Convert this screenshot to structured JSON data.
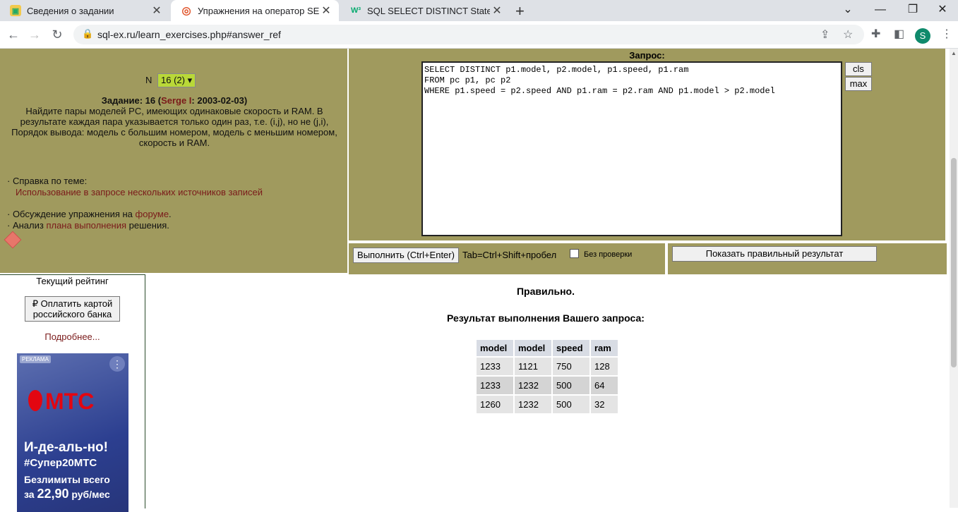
{
  "browser": {
    "tabs": [
      {
        "title": "Сведения о задании",
        "icon": "task-favicon"
      },
      {
        "title": "Упражнения на оператор SELECT",
        "icon": "sqlex-favicon"
      },
      {
        "title": "SQL SELECT DISTINCT Statement",
        "icon": "w3schools-favicon"
      }
    ],
    "url": "sql-ex.ru/learn_exercises.php#answer_ref",
    "profile_letter": "S"
  },
  "left": {
    "n_label": "N",
    "n_value": "16 (2)",
    "task_prefix": "Задание: 16 (",
    "task_author": "Serge I",
    "task_date": ": 2003-02-03)",
    "task_text": "Найдите пары моделей PC, имеющих одинаковые скорость и RAM. В результате каждая пара указывается только один раз, т.е. (i,j), но не (j,i), Порядок вывода: модель с большим номером, модель с меньшим номером, скорость и RAM.",
    "help_label": "· Справка по теме:",
    "help_link": "Использование в запросе нескольких источников записей",
    "forum_pre": "· Обсуждение упражнения на ",
    "forum_link": "форуме",
    "forum_post": ".",
    "plan_pre": "· Анализ ",
    "plan_link": "плана выполнения",
    "plan_post": " решения."
  },
  "query": {
    "label": "Запрос:",
    "text": "SELECT DISTINCT p1.model, p2.model, p1.speed, p1.ram\nFROM pc p1, pc p2\nWHERE p1.speed = p2.speed AND p1.ram = p2.ram AND p1.model > p2.model",
    "cls_label": "cls",
    "max_label": "max",
    "execute_label": "Выполнить (Ctrl+Enter)",
    "tab_hint": "Tab=Ctrl+Shift+пробел",
    "nocheck_label": "Без проверки",
    "show_result_label": "Показать правильный результат"
  },
  "sidebar": {
    "rating_label": "Текущий рейтинг",
    "pay_label": "₽ Оплатить картой российского банка",
    "more_label": "Подробнее...",
    "ad": {
      "badge": "РЕКЛАМА",
      "brand": "МТС",
      "line1": "И-де-аль-но!",
      "line2": "#Супер20МТС",
      "line3": "Безлимиты всего",
      "line4_pre": "за ",
      "line4_price": "22,90",
      "line4_post": " руб/мес"
    }
  },
  "result": {
    "status": "Правильно.",
    "heading": "Результат выполнения Вашего запроса:",
    "columns": [
      "model",
      "model",
      "speed",
      "ram"
    ],
    "rows": [
      [
        "1233",
        "1121",
        "750",
        "128"
      ],
      [
        "1233",
        "1232",
        "500",
        "64"
      ],
      [
        "1260",
        "1232",
        "500",
        "32"
      ]
    ]
  }
}
